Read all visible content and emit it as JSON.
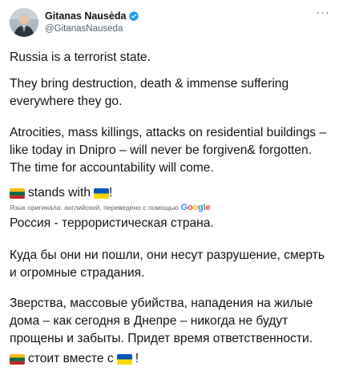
{
  "author": {
    "name": "Gitanas Nausėda",
    "handle": "@GitanasNauseda"
  },
  "more_icon": "ellipsis-horizontal",
  "tweet": {
    "p1": "Russia is a terrorist state.",
    "p2": "They bring destruction, death & immense suffering everywhere they go.",
    "p3": "Atrocities, mass killings, attacks on residential buildings – like today in Dnipro – will never be forgiven& forgotten. The time for accountability will come.",
    "p4_text": "stands with",
    "p4_suffix": "!"
  },
  "translation": {
    "note": "Язык оригинала: английский, переведено с помощью",
    "provider_parts": [
      "G",
      "o",
      "o",
      "g",
      "l",
      "e"
    ],
    "p1": "Россия - террористическая страна.",
    "p2": "Куда бы они ни пошли, они несут разрушение, смерть и огромные страдания.",
    "p3": "Зверства, массовые убийства, нападения на жилые дома – как сегодня в Днепре – никогда не будут прощены и забыты. Придет время ответственности.",
    "p4_text": "стоит вместе с",
    "p4_suffix": "!"
  },
  "colors": {
    "verified_badge": "#1d9bf0",
    "lithuania": [
      "#fdb913",
      "#006a44",
      "#c1272d"
    ],
    "ukraine": [
      "#0057b7",
      "#ffd700"
    ]
  }
}
